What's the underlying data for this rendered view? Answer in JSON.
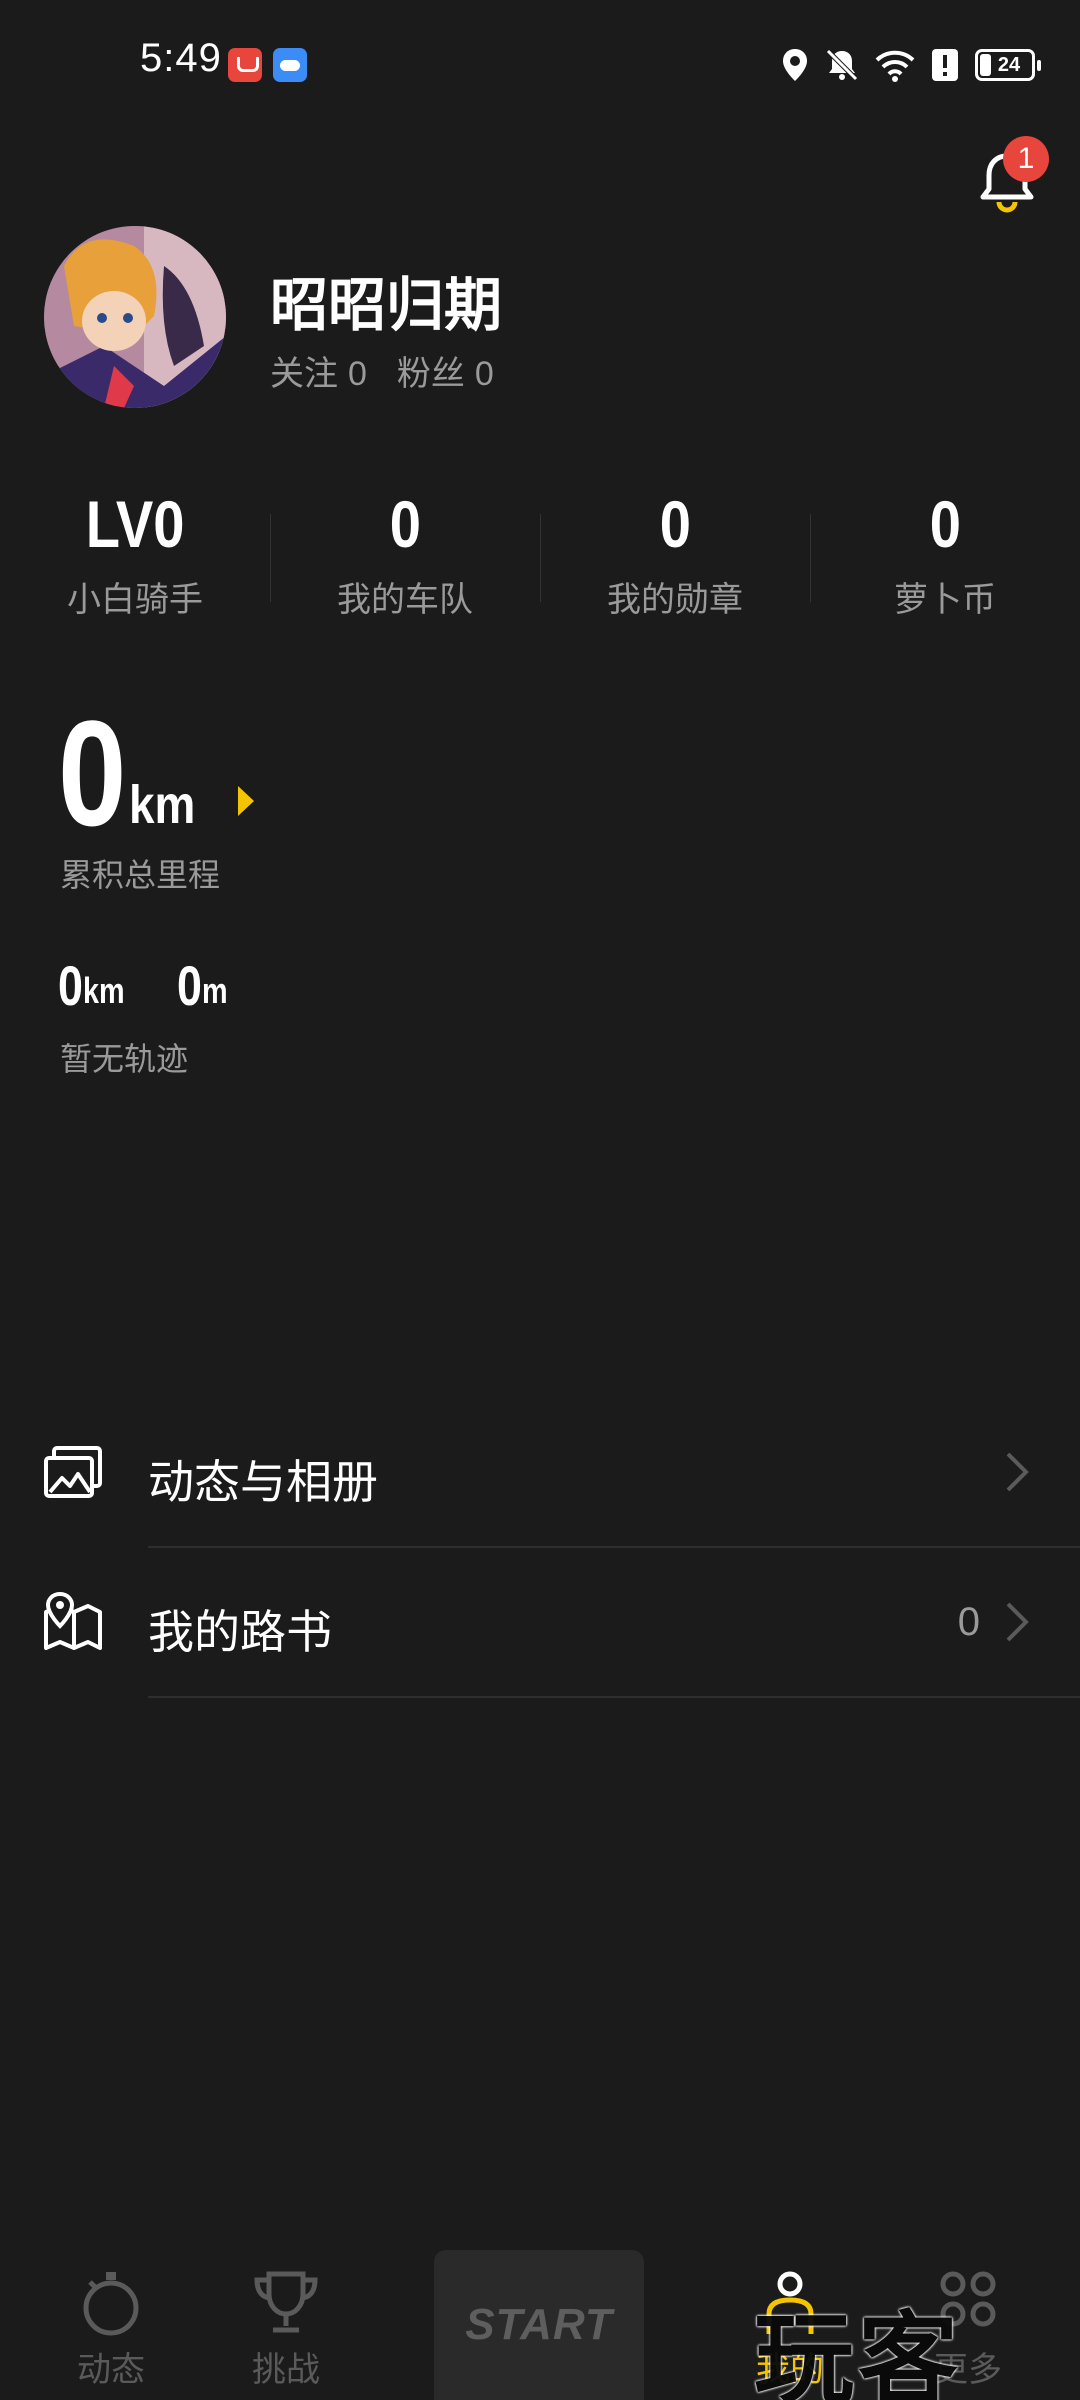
{
  "status_bar": {
    "time": "5:49",
    "battery": "24",
    "icons": [
      "location-icon",
      "bell-off-icon",
      "wifi-icon",
      "alert-icon",
      "battery-icon"
    ]
  },
  "header": {
    "notification_badge": "1"
  },
  "profile": {
    "username": "昭昭归期",
    "following_label": "关注",
    "following_count": "0",
    "fans_label": "粉丝",
    "fans_count": "0"
  },
  "stats": [
    {
      "value": "LV0",
      "label": "小白骑手"
    },
    {
      "value": "0",
      "label": "我的车队"
    },
    {
      "value": "0",
      "label": "我的勋章"
    },
    {
      "value": "0",
      "label": "萝卜币"
    }
  ],
  "mileage": {
    "total_value": "0",
    "total_unit": "km",
    "total_label": "累积总里程",
    "distance_value": "0",
    "distance_unit": "km",
    "elevation_value": "0",
    "elevation_unit": "m",
    "track_label": "暂无轨迹"
  },
  "menu": [
    {
      "label": "动态与相册",
      "icon": "photo-album-icon",
      "count": ""
    },
    {
      "label": "我的路书",
      "icon": "map-route-icon",
      "count": "0"
    }
  ],
  "bottom_nav": {
    "items": [
      {
        "label": "动态",
        "icon": "stopwatch-icon"
      },
      {
        "label": "挑战",
        "icon": "trophy-icon"
      },
      {
        "label": "START",
        "icon": ""
      },
      {
        "label": "我的",
        "icon": "person-icon"
      },
      {
        "label": "更多",
        "icon": "grid-icon"
      }
    ],
    "active": "我的"
  },
  "watermark": "玩客",
  "colors": {
    "background": "#1b1b1b",
    "accent": "#f5c400",
    "badge": "#e8453c",
    "muted_text": "#9a9a9a"
  }
}
